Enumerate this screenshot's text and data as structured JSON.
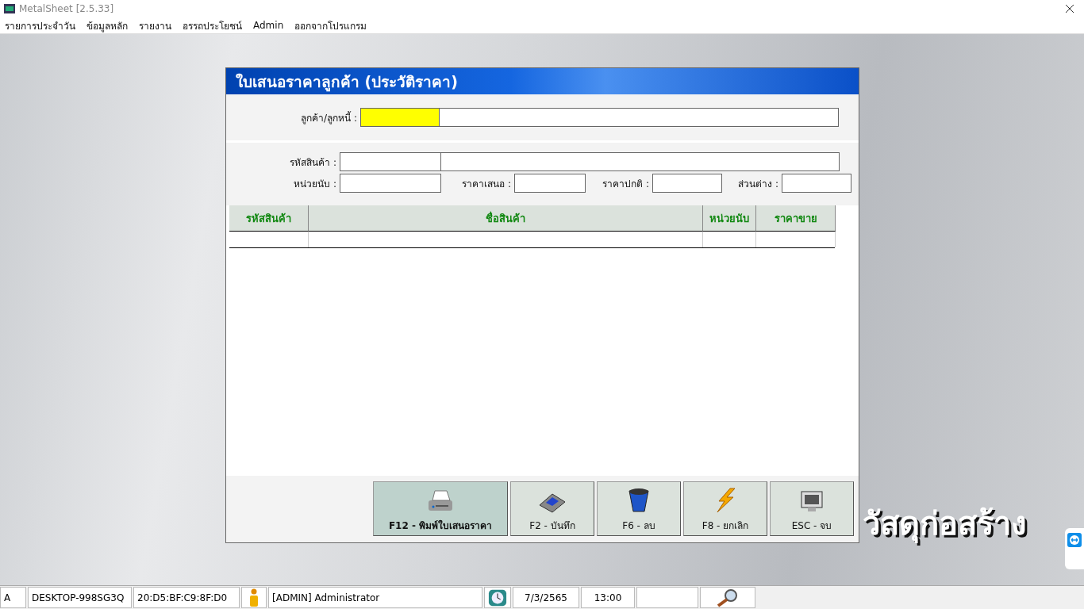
{
  "app": {
    "title": "MetalSheet [2.5.33]"
  },
  "menu": [
    "รายการประจำวัน",
    "ข้อมูลหลัก",
    "รายงาน",
    "อรรถประโยชน์",
    "Admin",
    "ออกจากโปรแกรม"
  ],
  "dialog": {
    "title": "ใบเสนอราคาลูกค้า (ประวัติราคา)",
    "customer": {
      "label": "ลูกค้า/ลูกหนี้ :",
      "highlighted": true
    },
    "product_code": {
      "label": "รหัสสินค้า :"
    },
    "price_fields": [
      {
        "label": "หน่วยนับ :"
      },
      {
        "label": "ราคาเสนอ :"
      },
      {
        "label": "ราคาปกติ :"
      },
      {
        "label": "ส่วนต่าง :"
      }
    ],
    "table": {
      "columns": [
        "รหัสสินค้า",
        "ชื่อสินค้า",
        "หน่วยนับ",
        "ราคาขาย"
      ]
    },
    "buttons": [
      {
        "label": "F12 - พิมพ์ใบเสนอราคา",
        "kind": "print",
        "selected": true
      },
      {
        "label": "F2 - บันทึก",
        "kind": "save",
        "selected": false
      },
      {
        "label": "F6 - ลบ",
        "kind": "delete",
        "selected": false
      },
      {
        "label": "F8 - ยกเลิก",
        "kind": "cancel",
        "selected": false
      },
      {
        "label": "ESC - จบ",
        "kind": "exit",
        "selected": false
      }
    ]
  },
  "slogan": "วัสดุก่อสร้าง",
  "status_bar": [
    {
      "kind": "text",
      "text": "A"
    },
    {
      "kind": "text",
      "text": "DESKTOP-998SG3Q"
    },
    {
      "kind": "text",
      "text": "20:D5:BF:C9:8F:D0"
    },
    {
      "kind": "user"
    },
    {
      "kind": "text",
      "text": "[ADMIN] Administrator"
    },
    {
      "kind": "clock"
    },
    {
      "kind": "text",
      "text": "7/3/2565"
    },
    {
      "kind": "text",
      "text": "13:00"
    },
    {
      "kind": "blank"
    },
    {
      "kind": "search"
    }
  ]
}
